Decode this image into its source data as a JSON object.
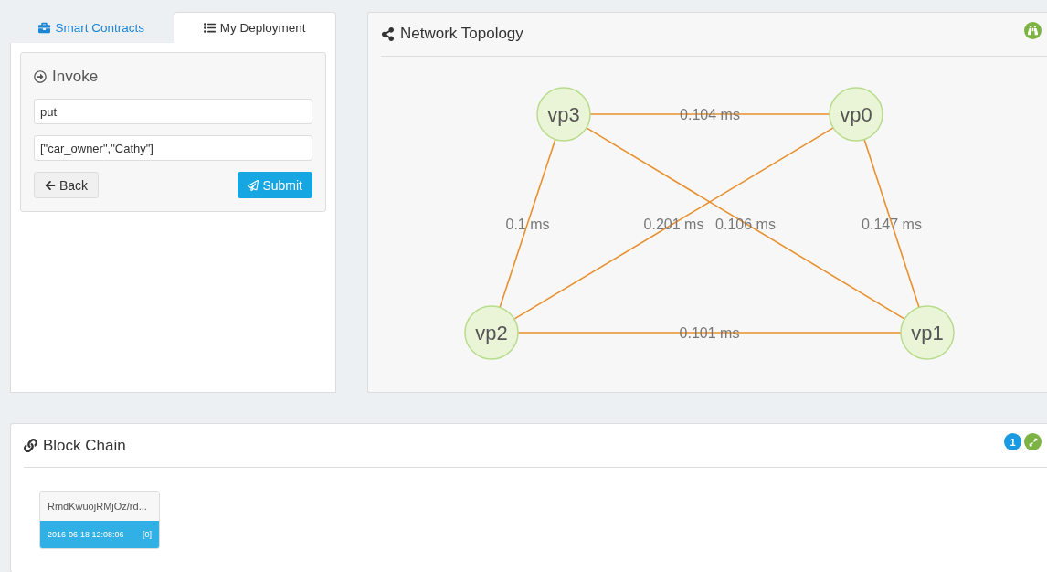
{
  "tabs": [
    {
      "label": "Smart Contracts",
      "selected": false
    },
    {
      "label": "My Deployment",
      "selected": true
    }
  ],
  "invoke": {
    "title": "Invoke",
    "function_field": {
      "value": "put"
    },
    "args_field": {
      "value": "[\"car_owner\",\"Cathy\"]"
    },
    "back_button": "Back",
    "submit_button": "Submit"
  },
  "topology": {
    "title": "Network Topology",
    "nodes": [
      {
        "label": "vp3"
      },
      {
        "label": "vp0"
      },
      {
        "label": "vp2"
      },
      {
        "label": "vp1"
      }
    ],
    "edges": [
      {
        "label": "0.104 ms"
      },
      {
        "label": "0.1 ms"
      },
      {
        "label": "0.201 ms"
      },
      {
        "label": "0.106 ms"
      },
      {
        "label": "0.147 ms"
      },
      {
        "label": "0.101 ms"
      }
    ]
  },
  "blockchain": {
    "title": "Block Chain",
    "count": "1",
    "blocks": [
      {
        "hash": "RmdKwuojRMjOz/rd...",
        "time": "2016-06-18 12:08:06",
        "index": "[0]"
      }
    ]
  }
}
